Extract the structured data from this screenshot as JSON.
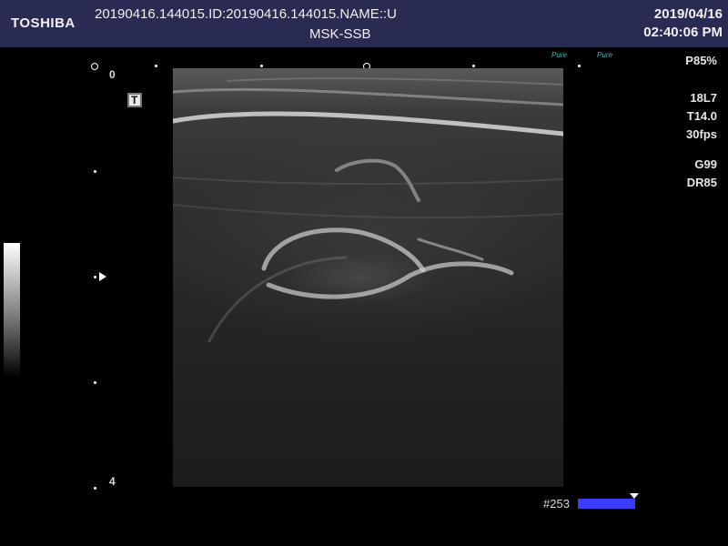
{
  "header": {
    "brand": "TOSHIBA",
    "patient_line": "20190416.144015.ID:20190416.144015.NAME::U",
    "preset": "MSK-SSB",
    "date": "2019/04/16",
    "time": "02:40:06 PM"
  },
  "parameters": {
    "power": "P85%",
    "probe": "18L7",
    "tis": "T14.0",
    "frame_rate": "30fps",
    "gain": "G99",
    "dynamic_range": "DR85"
  },
  "logos": {
    "left": "Pure",
    "right": "Pure"
  },
  "depth_scale": {
    "top": "0",
    "bottom": "4"
  },
  "t_marker": "T",
  "frame_counter": {
    "label": "#253",
    "bar_color": "#3a3cff"
  },
  "colors": {
    "header_bg": "#2a2b52",
    "logo_teal": "#4fb3b3"
  }
}
